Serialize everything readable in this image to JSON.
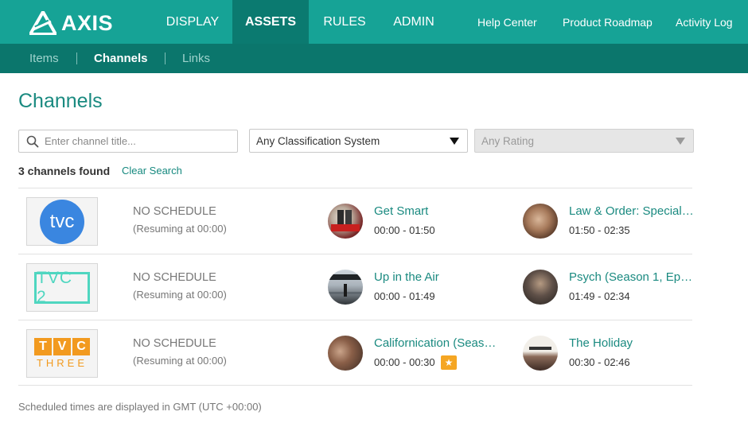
{
  "brand": {
    "name": "AXIS",
    "accent": "#16a396",
    "accent_dark": "#0b7a70"
  },
  "nav": {
    "main": [
      {
        "label": "DISPLAY",
        "active": false
      },
      {
        "label": "ASSETS",
        "active": true
      },
      {
        "label": "RULES",
        "active": false
      },
      {
        "label": "ADMIN",
        "active": false
      }
    ],
    "right": [
      {
        "label": "Help Center"
      },
      {
        "label": "Product Roadmap"
      },
      {
        "label": "Activity Log"
      }
    ]
  },
  "subnav": [
    {
      "label": "Items",
      "active": false
    },
    {
      "label": "Channels",
      "active": true
    },
    {
      "label": "Links",
      "active": false
    }
  ],
  "page": {
    "title": "Channels"
  },
  "filters": {
    "search_placeholder": "Enter channel title...",
    "classification": "Any Classification System",
    "rating": "Any Rating"
  },
  "results": {
    "count_text": "3 channels found",
    "clear_label": "Clear Search"
  },
  "channels": [
    {
      "logo_text": "tvc",
      "status": "NO SCHEDULE",
      "resume": "(Resuming at 00:00)",
      "programs": [
        {
          "title": "Get Smart",
          "time": "00:00 - 01:50",
          "thumb": "movie-thumb"
        },
        {
          "title": "Law & Order: Special…",
          "time": "01:50 - 02:35",
          "thumb": "movie-thumb"
        }
      ]
    },
    {
      "logo_text": "TVC 2",
      "status": "NO SCHEDULE",
      "resume": "(Resuming at 00:00)",
      "programs": [
        {
          "title": "Up in the Air",
          "time": "00:00 - 01:49",
          "thumb": "movie-thumb"
        },
        {
          "title": "Psych (Season 1, Ep…",
          "time": "01:49 - 02:34",
          "thumb": "movie-thumb"
        }
      ]
    },
    {
      "logo_text_top": "TVC",
      "logo_text_bottom": "THREE",
      "status": "NO SCHEDULE",
      "resume": "(Resuming at 00:00)",
      "programs": [
        {
          "title": "Californication (Seas…",
          "time": "00:00 - 00:30",
          "thumb": "movie-thumb",
          "badge": "star-icon"
        },
        {
          "title": "The Holiday",
          "time": "00:30 - 02:46",
          "thumb": "movie-thumb"
        }
      ]
    }
  ],
  "footnote": "Scheduled times are displayed in GMT (UTC +00:00)"
}
